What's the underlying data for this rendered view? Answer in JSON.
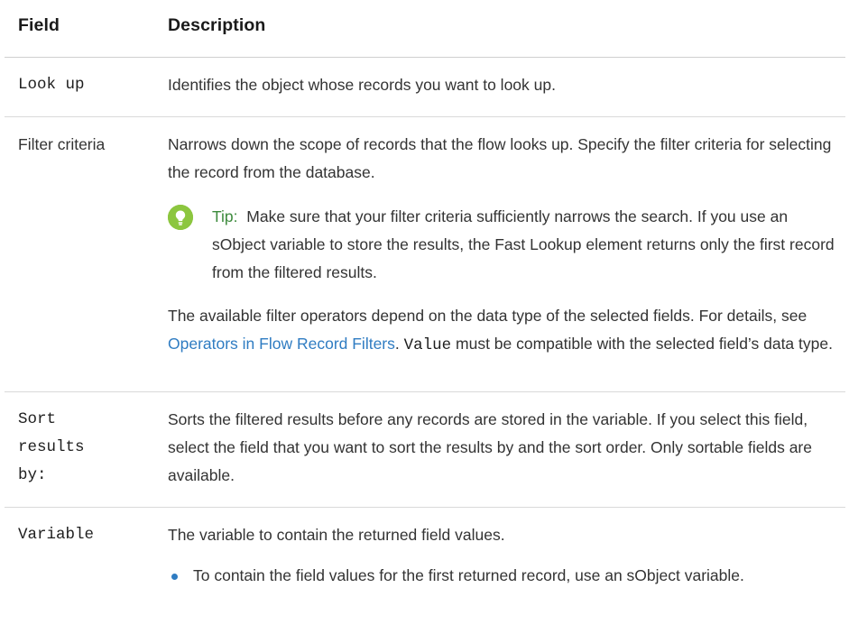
{
  "table": {
    "headers": {
      "field": "Field",
      "description": "Description"
    },
    "rows": {
      "lookup": {
        "field": "Look up",
        "description": "Identifies the object whose records you want to look up."
      },
      "filter": {
        "field": "Filter criteria",
        "description": "Narrows down the scope of records that the flow looks up. Specify the filter criteria for selecting the record from the database.",
        "tip_label": "Tip:",
        "tip_text": "Make sure that your filter criteria sufficiently narrows the search. If you use an sObject variable to store the results, the Fast Lookup element returns only the first record from the filtered results.",
        "operators_before": "The available filter operators depend on the data type of the selected fields. For details, see ",
        "operators_link": "Operators in Flow Record Filters",
        "operators_mid": ". ",
        "operators_code": "Value",
        "operators_after": " must be compatible with the selected field’s data type."
      },
      "sort": {
        "field": "Sort results by:",
        "description": "Sorts the filtered results before any records are stored in the variable. If you select this field, select the field that you want to sort the results by and the sort order. Only sortable fields are available."
      },
      "variable": {
        "field": "Variable",
        "description": "The variable to contain the returned field values.",
        "bullet": "To contain the field values for the first returned record, use an sObject variable."
      }
    }
  },
  "icons": {
    "tip": "lightbulb-icon",
    "bullet": "bullet-dot"
  },
  "colors": {
    "link": "#2f7cc2",
    "tip_label": "#3d8b3d",
    "tip_icon": "#8cc63f",
    "divider": "#d9d9d9"
  }
}
